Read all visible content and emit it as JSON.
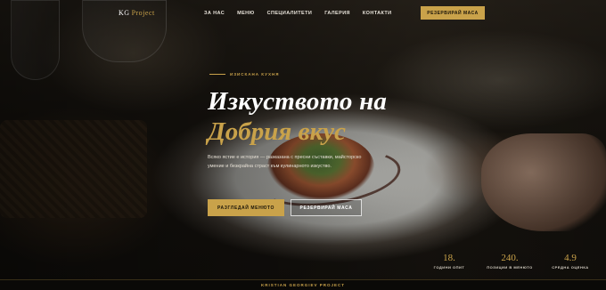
{
  "brand": {
    "name": "KG",
    "suffix": "Project"
  },
  "nav": {
    "items": [
      "ЗА НАС",
      "МЕНЮ",
      "СПЕЦИАЛИТЕТИ",
      "ГАЛЕРИЯ",
      "КОНТАКТИ"
    ],
    "reserve_label": "РЕЗЕРВИРАЙ МАСА"
  },
  "hero": {
    "kicker": "ИЗИСКАНА КУХНЯ",
    "title_line1": "Изкуството на",
    "title_line2": "Добрия вкус",
    "description": "Всяко ястие е история — разказана с пресни съставки, майсторско умение и безкрайна страст към кулинарното изкуство.",
    "btn_menu": "РАЗГЛЕДАЙ МЕНЮТО",
    "btn_reserve": "РЕЗЕРВИРАЙ МАСА"
  },
  "stats": [
    {
      "value": "18.",
      "label": "ГОДИНИ ОПИТ"
    },
    {
      "value": "240.",
      "label": "ПОЗИЦИИ В МЕНЮТО"
    },
    {
      "value": "4.9",
      "label": "СРЕДНА ОЦЕНКА"
    }
  ],
  "footer": {
    "text": "KRISTIAN GEORGIEV PROJECT"
  },
  "colors": {
    "accent": "#c9a24a",
    "background": "#0c0b09"
  }
}
